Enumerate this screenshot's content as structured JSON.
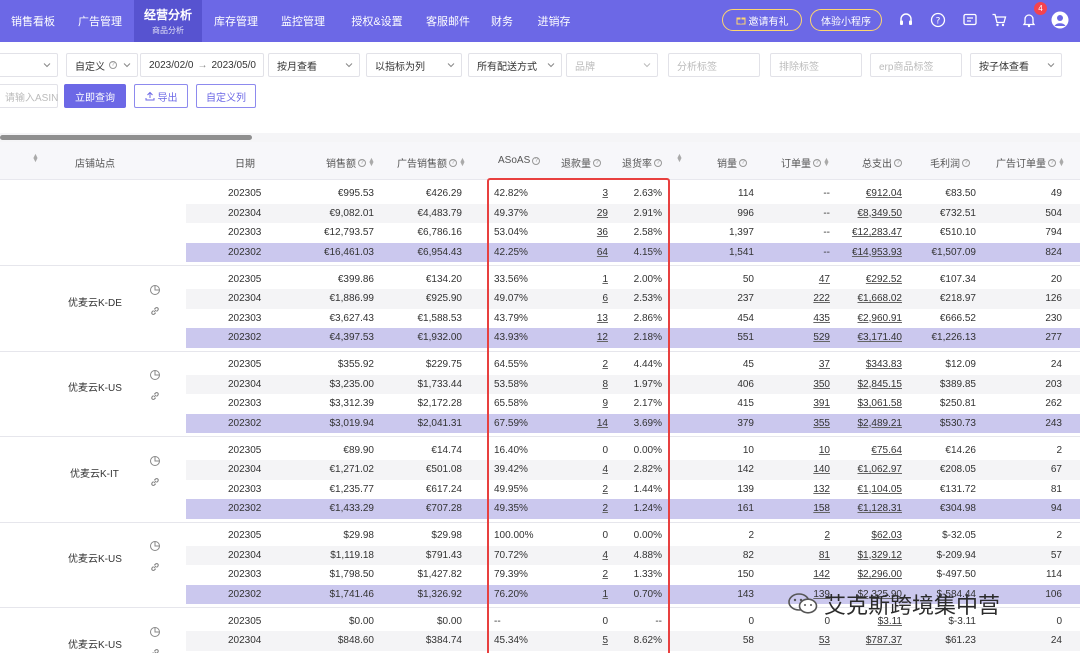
{
  "nav": {
    "items": [
      {
        "label": "销售看板",
        "sub": ""
      },
      {
        "label": "广告管理",
        "sub": ""
      },
      {
        "label": "经营分析",
        "sub": "商品分析"
      },
      {
        "label": "库存管理",
        "sub": ""
      },
      {
        "label": "监控管理",
        "sub": ""
      },
      {
        "label": "授权&设置",
        "sub": ""
      },
      {
        "label": "客服邮件",
        "sub": ""
      },
      {
        "label": "财务",
        "sub": ""
      },
      {
        "label": "进销存",
        "sub": ""
      }
    ],
    "invite_label": "邀请有礼",
    "try_label": "体验小程序",
    "notification_count": "4",
    "icons": [
      "headset-icon",
      "help-icon",
      "message-icon",
      "cart-icon",
      "bell-icon",
      "user-avatar-icon"
    ]
  },
  "filters": {
    "date_mode": "自定义",
    "date_start": "2023/02/0",
    "date_end": "2023/05/0",
    "view_by": "按月查看",
    "column_mode": "以指标为列",
    "shipping": "所有配送方式",
    "brand_placeholder": "品牌",
    "category_placeholder": "分析标签",
    "sort_tag_placeholder": "排除标签",
    "erp_tag_placeholder": "erp商品标签",
    "entity_view": "按子体查看",
    "asin_placeholder": "请输入ASIN"
  },
  "buttons": {
    "query": "立即查询",
    "export": "导出",
    "custom_columns": "自定义列"
  },
  "table": {
    "headers": {
      "store": "店铺站点",
      "date": "日期",
      "sales": "销售额",
      "ad_sales": "广告销售额",
      "asoas": "ASoAS",
      "returns": "退款量",
      "return_rate": "退货率",
      "units": "销量",
      "orders": "订单量",
      "total_cost": "总支出",
      "gross_profit": "毛利润",
      "ad_orders": "广告订单量"
    },
    "groups": [
      {
        "store": "",
        "rows": [
          {
            "date": "202305",
            "sales": "€995.53",
            "ad_sales": "€426.29",
            "asoas": "42.82%",
            "returns": "3",
            "return_rate": "2.63%",
            "units": "114",
            "orders": "--",
            "total_cost": "€912.04",
            "gross_profit": "€83.50",
            "ad_orders": "49"
          },
          {
            "date": "202304",
            "sales": "€9,082.01",
            "ad_sales": "€4,483.79",
            "asoas": "49.37%",
            "returns": "29",
            "return_rate": "2.91%",
            "units": "996",
            "orders": "--",
            "total_cost": "€8,349.50",
            "gross_profit": "€732.51",
            "ad_orders": "504"
          },
          {
            "date": "202303",
            "sales": "€12,793.57",
            "ad_sales": "€6,786.16",
            "asoas": "53.04%",
            "returns": "36",
            "return_rate": "2.58%",
            "units": "1,397",
            "orders": "--",
            "total_cost": "€12,283.47",
            "gross_profit": "€510.10",
            "ad_orders": "794"
          },
          {
            "date": "202302",
            "sales": "€16,461.03",
            "ad_sales": "€6,954.43",
            "asoas": "42.25%",
            "returns": "64",
            "return_rate": "4.15%",
            "units": "1,541",
            "orders": "--",
            "total_cost": "€14,953.93",
            "gross_profit": "€1,507.09",
            "ad_orders": "824"
          }
        ]
      },
      {
        "store": "优麦云K-DE",
        "rows": [
          {
            "date": "202305",
            "sales": "€399.86",
            "ad_sales": "€134.20",
            "asoas": "33.56%",
            "returns": "1",
            "return_rate": "2.00%",
            "units": "50",
            "orders": "47",
            "total_cost": "€292.52",
            "gross_profit": "€107.34",
            "ad_orders": "20"
          },
          {
            "date": "202304",
            "sales": "€1,886.99",
            "ad_sales": "€925.90",
            "asoas": "49.07%",
            "returns": "6",
            "return_rate": "2.53%",
            "units": "237",
            "orders": "222",
            "total_cost": "€1,668.02",
            "gross_profit": "€218.97",
            "ad_orders": "126"
          },
          {
            "date": "202303",
            "sales": "€3,627.43",
            "ad_sales": "€1,588.53",
            "asoas": "43.79%",
            "returns": "13",
            "return_rate": "2.86%",
            "units": "454",
            "orders": "435",
            "total_cost": "€2,960.91",
            "gross_profit": "€666.52",
            "ad_orders": "230"
          },
          {
            "date": "202302",
            "sales": "€4,397.53",
            "ad_sales": "€1,932.00",
            "asoas": "43.93%",
            "returns": "12",
            "return_rate": "2.18%",
            "units": "551",
            "orders": "529",
            "total_cost": "€3,171.40",
            "gross_profit": "€1,226.13",
            "ad_orders": "277"
          }
        ]
      },
      {
        "store": "优麦云K-US",
        "rows": [
          {
            "date": "202305",
            "sales": "$355.92",
            "ad_sales": "$229.75",
            "asoas": "64.55%",
            "returns": "2",
            "return_rate": "4.44%",
            "units": "45",
            "orders": "37",
            "total_cost": "$343.83",
            "gross_profit": "$12.09",
            "ad_orders": "24"
          },
          {
            "date": "202304",
            "sales": "$3,235.00",
            "ad_sales": "$1,733.44",
            "asoas": "53.58%",
            "returns": "8",
            "return_rate": "1.97%",
            "units": "406",
            "orders": "350",
            "total_cost": "$2,845.15",
            "gross_profit": "$389.85",
            "ad_orders": "203"
          },
          {
            "date": "202303",
            "sales": "$3,312.39",
            "ad_sales": "$2,172.28",
            "asoas": "65.58%",
            "returns": "9",
            "return_rate": "2.17%",
            "units": "415",
            "orders": "391",
            "total_cost": "$3,061.58",
            "gross_profit": "$250.81",
            "ad_orders": "262"
          },
          {
            "date": "202302",
            "sales": "$3,019.94",
            "ad_sales": "$2,041.31",
            "asoas": "67.59%",
            "returns": "14",
            "return_rate": "3.69%",
            "units": "379",
            "orders": "355",
            "total_cost": "$2,489.21",
            "gross_profit": "$530.73",
            "ad_orders": "243"
          }
        ]
      },
      {
        "store": "优麦云K-IT",
        "rows": [
          {
            "date": "202305",
            "sales": "€89.90",
            "ad_sales": "€14.74",
            "asoas": "16.40%",
            "returns": "0",
            "return_rate": "0.00%",
            "units": "10",
            "orders": "10",
            "total_cost": "€75.64",
            "gross_profit": "€14.26",
            "ad_orders": "2"
          },
          {
            "date": "202304",
            "sales": "€1,271.02",
            "ad_sales": "€501.08",
            "asoas": "39.42%",
            "returns": "4",
            "return_rate": "2.82%",
            "units": "142",
            "orders": "140",
            "total_cost": "€1,062.97",
            "gross_profit": "€208.05",
            "ad_orders": "67"
          },
          {
            "date": "202303",
            "sales": "€1,235.77",
            "ad_sales": "€617.24",
            "asoas": "49.95%",
            "returns": "2",
            "return_rate": "1.44%",
            "units": "139",
            "orders": "132",
            "total_cost": "€1,104.05",
            "gross_profit": "€131.72",
            "ad_orders": "81"
          },
          {
            "date": "202302",
            "sales": "€1,433.29",
            "ad_sales": "€707.28",
            "asoas": "49.35%",
            "returns": "2",
            "return_rate": "1.24%",
            "units": "161",
            "orders": "158",
            "total_cost": "€1,128.31",
            "gross_profit": "€304.98",
            "ad_orders": "94"
          }
        ]
      },
      {
        "store": "优麦云K-US",
        "rows": [
          {
            "date": "202305",
            "sales": "$29.98",
            "ad_sales": "$29.98",
            "asoas": "100.00%",
            "returns": "0",
            "return_rate": "0.00%",
            "units": "2",
            "orders": "2",
            "total_cost": "$62.03",
            "gross_profit": "$-32.05",
            "ad_orders": "2"
          },
          {
            "date": "202304",
            "sales": "$1,119.18",
            "ad_sales": "$791.43",
            "asoas": "70.72%",
            "returns": "4",
            "return_rate": "4.88%",
            "units": "82",
            "orders": "81",
            "total_cost": "$1,329.12",
            "gross_profit": "$-209.94",
            "ad_orders": "57"
          },
          {
            "date": "202303",
            "sales": "$1,798.50",
            "ad_sales": "$1,427.82",
            "asoas": "79.39%",
            "returns": "2",
            "return_rate": "1.33%",
            "units": "150",
            "orders": "142",
            "total_cost": "$2,296.00",
            "gross_profit": "$-497.50",
            "ad_orders": "114"
          },
          {
            "date": "202302",
            "sales": "$1,741.46",
            "ad_sales": "$1,326.92",
            "asoas": "76.20%",
            "returns": "1",
            "return_rate": "0.70%",
            "units": "143",
            "orders": "139",
            "total_cost": "$2,325.90",
            "gross_profit": "$-584.44",
            "ad_orders": "106"
          }
        ]
      },
      {
        "store": "优麦云K-US",
        "rows": [
          {
            "date": "202305",
            "sales": "$0.00",
            "ad_sales": "$0.00",
            "asoas": "--",
            "returns": "0",
            "return_rate": "--",
            "units": "0",
            "orders": "0",
            "total_cost": "$3.11",
            "gross_profit": "$-3.11",
            "ad_orders": "0"
          },
          {
            "date": "202304",
            "sales": "$848.60",
            "ad_sales": "$384.74",
            "asoas": "45.34%",
            "returns": "5",
            "return_rate": "8.62%",
            "units": "58",
            "orders": "53",
            "total_cost": "$787.37",
            "gross_profit": "$61.23",
            "ad_orders": "24"
          }
        ]
      }
    ]
  },
  "watermark": "艾克斯跨境集中营",
  "colors": {
    "brand": "#6c68e6",
    "highlight_row": "#cbc8ee",
    "red_box": "#e8403f"
  }
}
